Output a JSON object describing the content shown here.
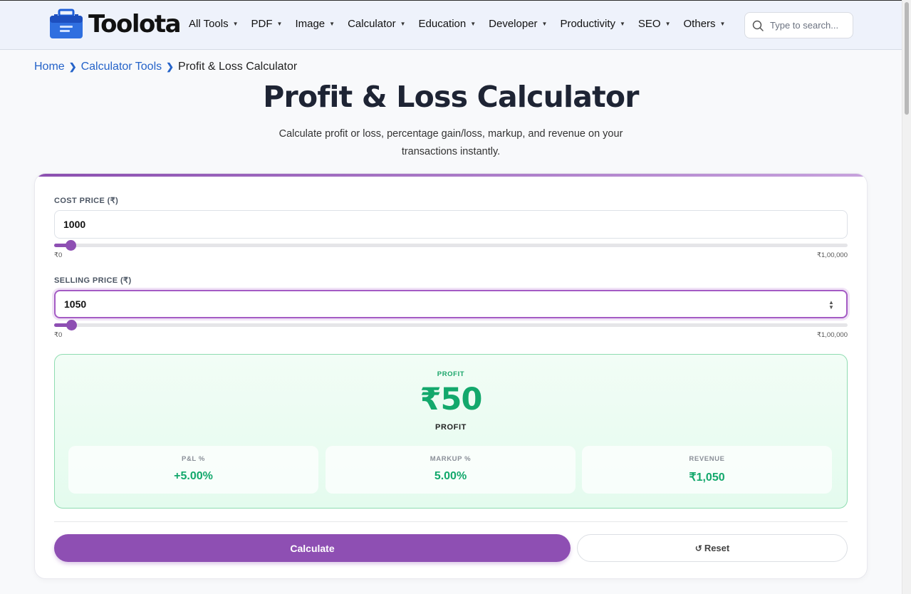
{
  "brand": {
    "name": "Toolota",
    "colors": {
      "primary": "#8e4fb3",
      "profit": "#13a86c",
      "link": "#2563c9"
    }
  },
  "nav": {
    "items": [
      {
        "label": "All Tools"
      },
      {
        "label": "PDF"
      },
      {
        "label": "Image"
      },
      {
        "label": "Calculator"
      },
      {
        "label": "Education"
      },
      {
        "label": "Developer"
      },
      {
        "label": "Productivity"
      },
      {
        "label": "SEO"
      },
      {
        "label": "Others"
      }
    ],
    "search_placeholder": "Type to search..."
  },
  "breadcrumb": {
    "home": "Home",
    "category": "Calculator Tools",
    "current": "Profit & Loss Calculator"
  },
  "page": {
    "title": "Profit & Loss Calculator",
    "subtitle": "Calculate profit or loss, percentage gain/loss, markup, and revenue on your transactions instantly."
  },
  "form": {
    "cost": {
      "label": "COST PRICE (₹)",
      "value": "1000",
      "slider_min": "₹0",
      "slider_max": "₹1,00,000",
      "slider_fraction": 0.01
    },
    "selling": {
      "label": "SELLING PRICE (₹)",
      "value": "1050",
      "slider_min": "₹0",
      "slider_max": "₹1,00,000",
      "slider_fraction": 0.0105
    }
  },
  "result": {
    "tag": "PROFIT",
    "amount": "₹50",
    "caption": "PROFIT",
    "stats": [
      {
        "label": "P&L %",
        "value": "+5.00%"
      },
      {
        "label": "MARKUP %",
        "value": "5.00%"
      },
      {
        "label": "REVENUE",
        "value": "₹1,050"
      }
    ]
  },
  "actions": {
    "calculate": "Calculate",
    "reset": "Reset"
  }
}
